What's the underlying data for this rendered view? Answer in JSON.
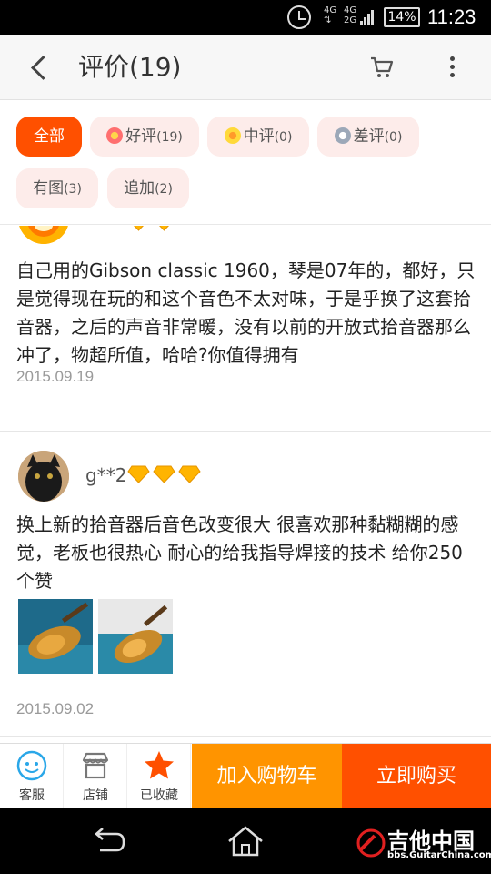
{
  "status_bar": {
    "net_top": "4G",
    "net_bottom": "4G",
    "net_bottom2": "2G",
    "battery": "14%",
    "time": "11:23"
  },
  "header": {
    "title": "评价(19)",
    "back_icon": "chevron-left-icon",
    "cart_icon": "cart-icon",
    "more_icon": "more-vertical-icon"
  },
  "filters": {
    "all": "全部",
    "good": "好评",
    "good_count": "(19)",
    "mid": "中评",
    "mid_count": "(0)",
    "bad": "差评",
    "bad_count": "(0)",
    "with_pic": "有图",
    "with_pic_count": "(3)",
    "appended": "追加",
    "appended_count": "(2)"
  },
  "reviews": [
    {
      "user": "",
      "text": "自己用的Gibson classic 1960，琴是07年的，都好，只是觉得现在玩的和这个音色不太对味，于是乎换了这套拾音器，之后的声音非常暖，没有以前的开放式拾音器那么冲了，物超所值，哈哈?你值得拥有",
      "date": "2015.09.19"
    },
    {
      "user": "g**2",
      "level": 3,
      "text": "换上新的拾音器后音色改变很大 很喜欢那种黏糊糊的感觉，老板也很热心 耐心的给我指导焊接的技术 给你250个赞",
      "date": "2015.09.02"
    }
  ],
  "action_bar": {
    "service": "客服",
    "shop": "店铺",
    "favorited": "已收藏",
    "add_to_cart": "加入购物车",
    "buy_now": "立即购买"
  },
  "watermark": {
    "name": "吉他中国",
    "url": "bbs.GuitarChina.com"
  },
  "colors": {
    "accent": "#ff5000",
    "cart_button": "#ff9400",
    "chip_bg": "#fdecea"
  }
}
